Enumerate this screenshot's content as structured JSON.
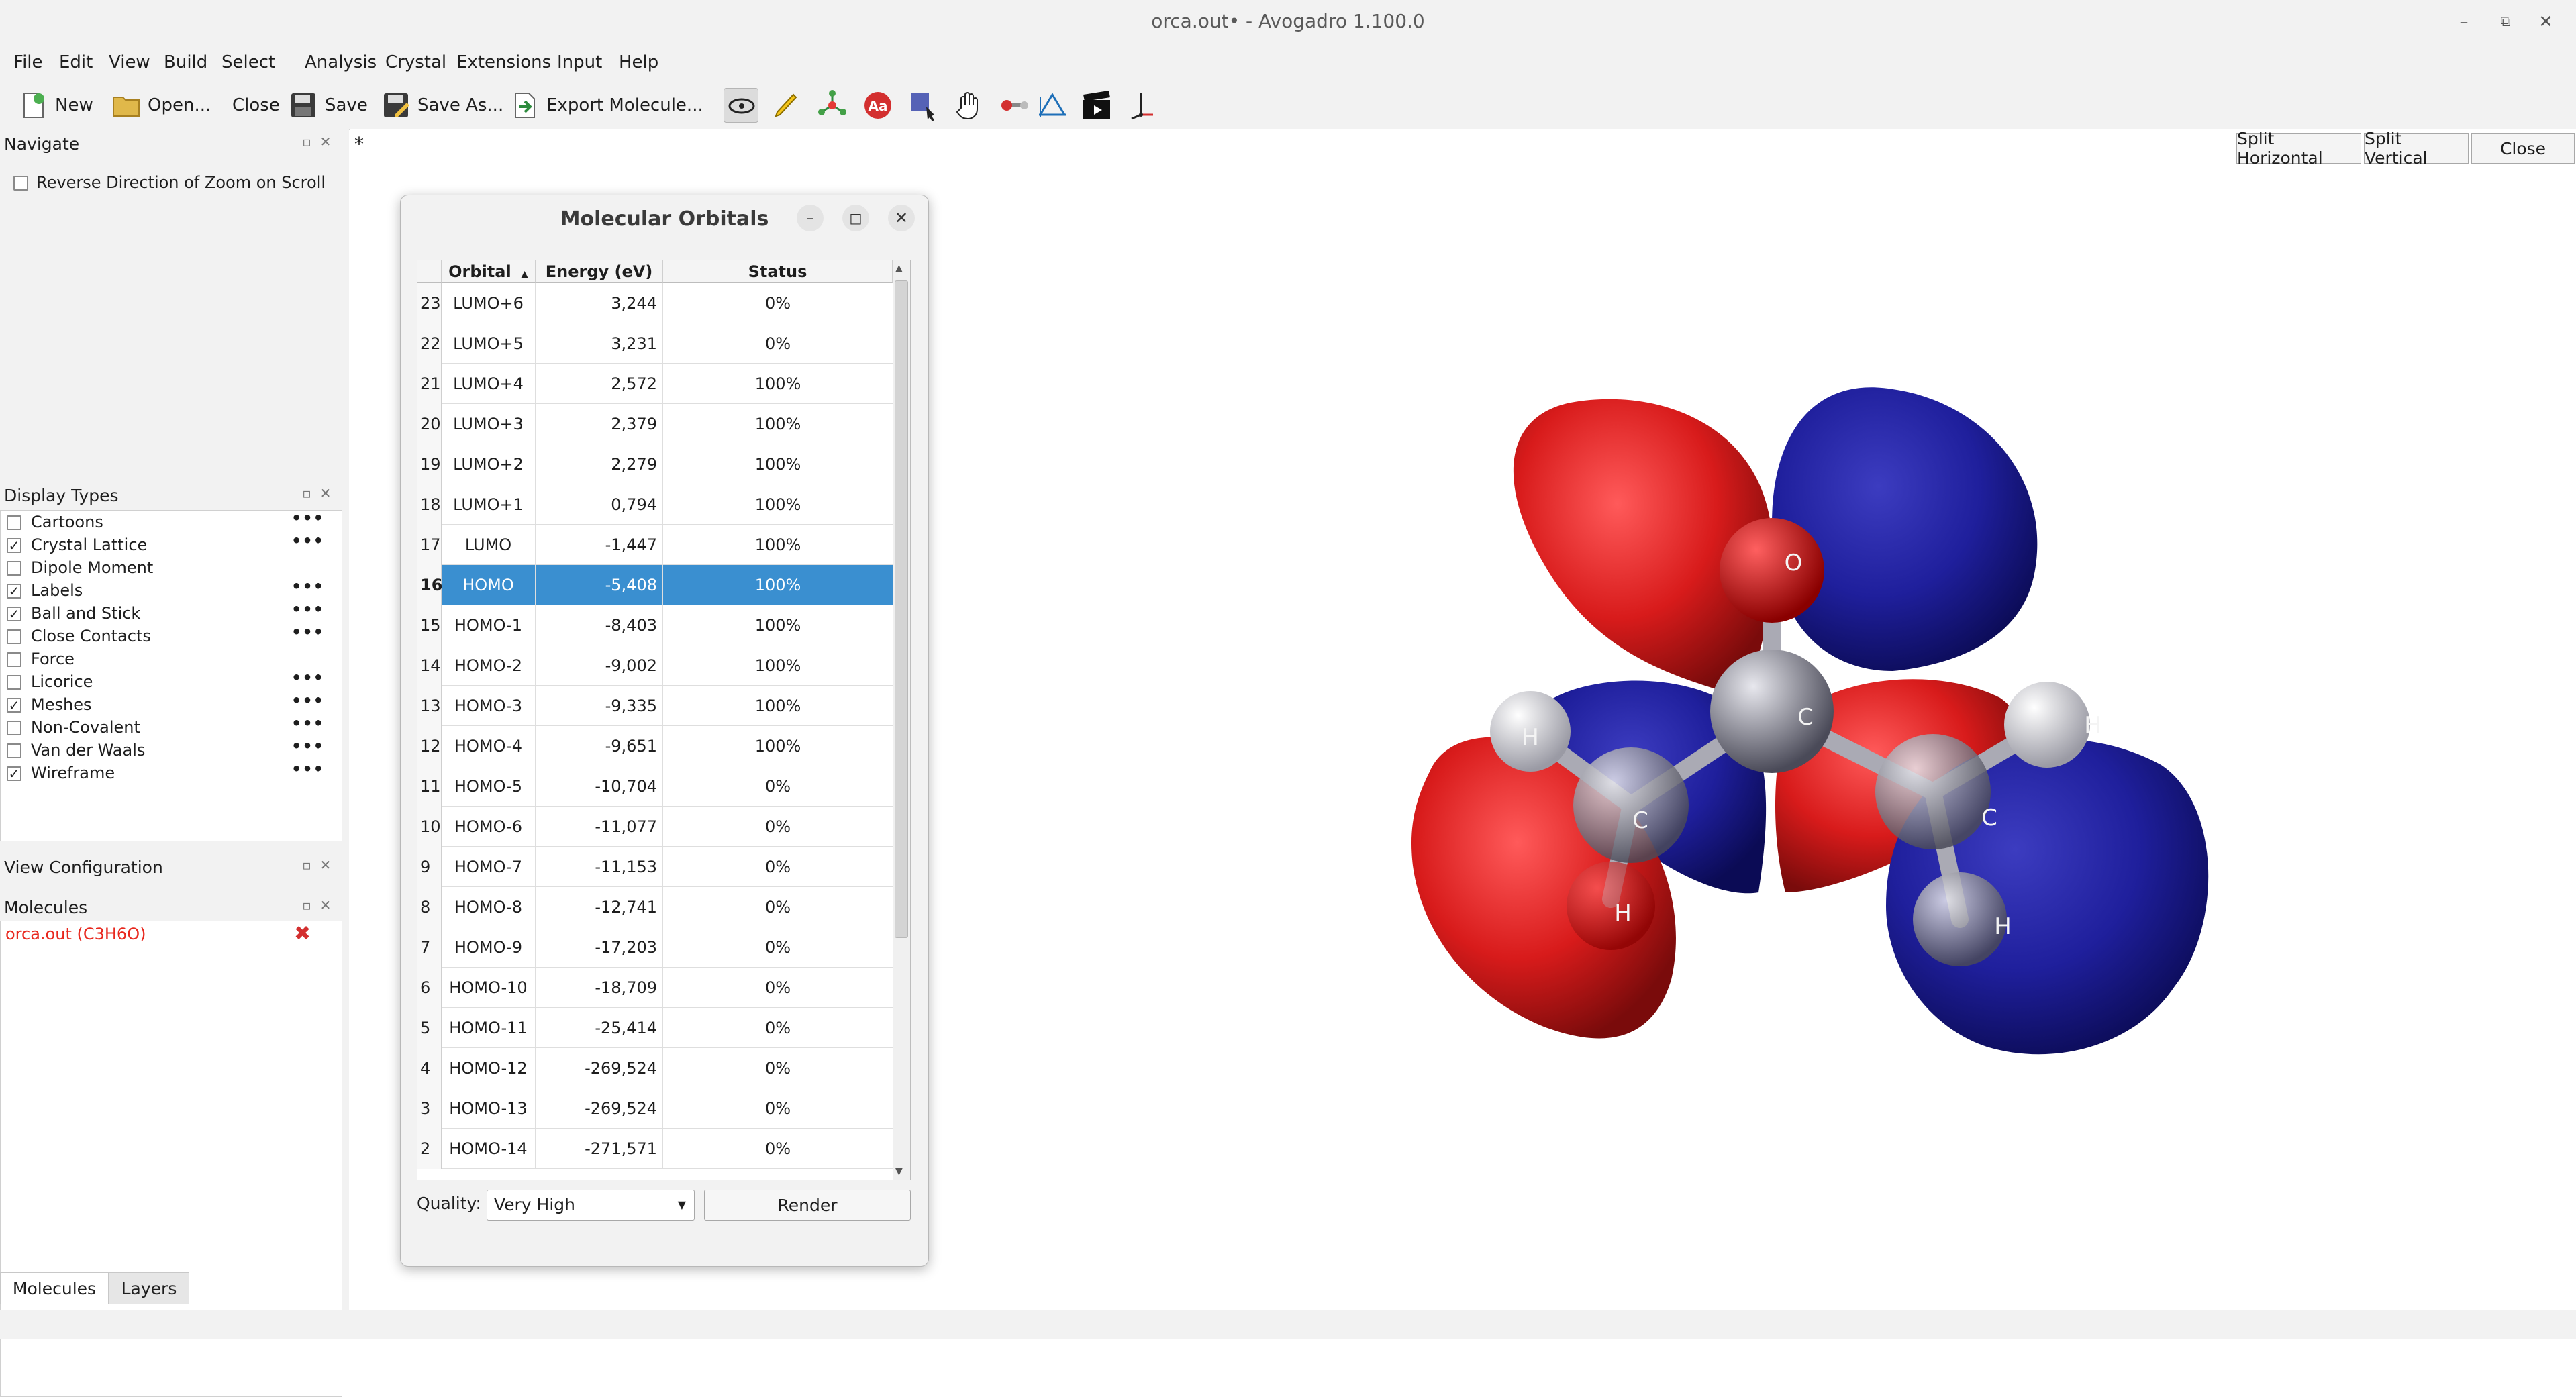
{
  "window": {
    "title": "orca.out• - Avogadro 1.100.0"
  },
  "menu": [
    "File",
    "Edit",
    "View",
    "Build",
    "Select",
    "Analysis",
    "Crystal",
    "Extensions",
    "Input",
    "Help"
  ],
  "toolbar": {
    "new": "New",
    "open": "Open...",
    "close": "Close",
    "save": "Save",
    "save_as": "Save As...",
    "export": "Export Molecule..."
  },
  "tab_marker": "*",
  "navigate": {
    "title": "Navigate",
    "reverse_zoom": "Reverse Direction of Zoom on Scroll"
  },
  "display_types": {
    "title": "Display Types",
    "items": [
      {
        "label": "Cartoons",
        "checked": false,
        "dots": "•••"
      },
      {
        "label": "Crystal Lattice",
        "checked": true,
        "dots": "•••"
      },
      {
        "label": "Dipole Moment",
        "checked": false,
        "dots": ""
      },
      {
        "label": "Labels",
        "checked": true,
        "dots": "•••"
      },
      {
        "label": "Ball and Stick",
        "checked": true,
        "dots": "•••"
      },
      {
        "label": "Close Contacts",
        "checked": false,
        "dots": "•••"
      },
      {
        "label": "Force",
        "checked": false,
        "dots": ""
      },
      {
        "label": "Licorice",
        "checked": false,
        "dots": "•••"
      },
      {
        "label": "Meshes",
        "checked": true,
        "dots": "•••"
      },
      {
        "label": "Non-Covalent",
        "checked": false,
        "dots": "•••"
      },
      {
        "label": "Van der Waals",
        "checked": false,
        "dots": "•••"
      },
      {
        "label": "Wireframe",
        "checked": true,
        "dots": "•••"
      }
    ]
  },
  "view_config": {
    "title": "View Configuration"
  },
  "molecules": {
    "title": "Molecules",
    "items": [
      "orca.out (C3H6O)"
    ]
  },
  "bottom_tabs": [
    "Molecules",
    "Layers"
  ],
  "split": {
    "horizontal": "Split Horizontal",
    "vertical": "Split Vertical",
    "close": "Close"
  },
  "mo_dialog": {
    "title": "Molecular Orbitals",
    "headers": [
      "Orbital",
      "Energy (eV)",
      "Status"
    ],
    "rows": [
      {
        "n": "23",
        "orbital": "LUMO+6",
        "energy": "3,244",
        "status": "0%"
      },
      {
        "n": "22",
        "orbital": "LUMO+5",
        "energy": "3,231",
        "status": "0%"
      },
      {
        "n": "21",
        "orbital": "LUMO+4",
        "energy": "2,572",
        "status": "100%"
      },
      {
        "n": "20",
        "orbital": "LUMO+3",
        "energy": "2,379",
        "status": "100%"
      },
      {
        "n": "19",
        "orbital": "LUMO+2",
        "energy": "2,279",
        "status": "100%"
      },
      {
        "n": "18",
        "orbital": "LUMO+1",
        "energy": "0,794",
        "status": "100%"
      },
      {
        "n": "17",
        "orbital": "LUMO",
        "energy": "-1,447",
        "status": "100%"
      },
      {
        "n": "16",
        "orbital": "HOMO",
        "energy": "-5,408",
        "status": "100%",
        "selected": true
      },
      {
        "n": "15",
        "orbital": "HOMO-1",
        "energy": "-8,403",
        "status": "100%"
      },
      {
        "n": "14",
        "orbital": "HOMO-2",
        "energy": "-9,002",
        "status": "100%"
      },
      {
        "n": "13",
        "orbital": "HOMO-3",
        "energy": "-9,335",
        "status": "100%"
      },
      {
        "n": "12",
        "orbital": "HOMO-4",
        "energy": "-9,651",
        "status": "100%"
      },
      {
        "n": "11",
        "orbital": "HOMO-5",
        "energy": "-10,704",
        "status": "0%"
      },
      {
        "n": "10",
        "orbital": "HOMO-6",
        "energy": "-11,077",
        "status": "0%"
      },
      {
        "n": "9",
        "orbital": "HOMO-7",
        "energy": "-11,153",
        "status": "0%"
      },
      {
        "n": "8",
        "orbital": "HOMO-8",
        "energy": "-12,741",
        "status": "0%"
      },
      {
        "n": "7",
        "orbital": "HOMO-9",
        "energy": "-17,203",
        "status": "0%"
      },
      {
        "n": "6",
        "orbital": "HOMO-10",
        "energy": "-18,709",
        "status": "0%"
      },
      {
        "n": "5",
        "orbital": "HOMO-11",
        "energy": "-25,414",
        "status": "0%"
      },
      {
        "n": "4",
        "orbital": "HOMO-12",
        "energy": "-269,524",
        "status": "0%"
      },
      {
        "n": "3",
        "orbital": "HOMO-13",
        "energy": "-269,524",
        "status": "0%"
      },
      {
        "n": "2",
        "orbital": "HOMO-14",
        "energy": "-271,571",
        "status": "0%"
      }
    ],
    "quality_label": "Quality:",
    "quality_value": "Very High",
    "render": "Render"
  },
  "atom_labels": [
    "O",
    "C",
    "C",
    "C",
    "H",
    "H",
    "H",
    "H"
  ],
  "colors": {
    "positive_lobe": "#d81b1b",
    "negative_lobe": "#1f1f9c",
    "selection": "#3a8fd0"
  }
}
